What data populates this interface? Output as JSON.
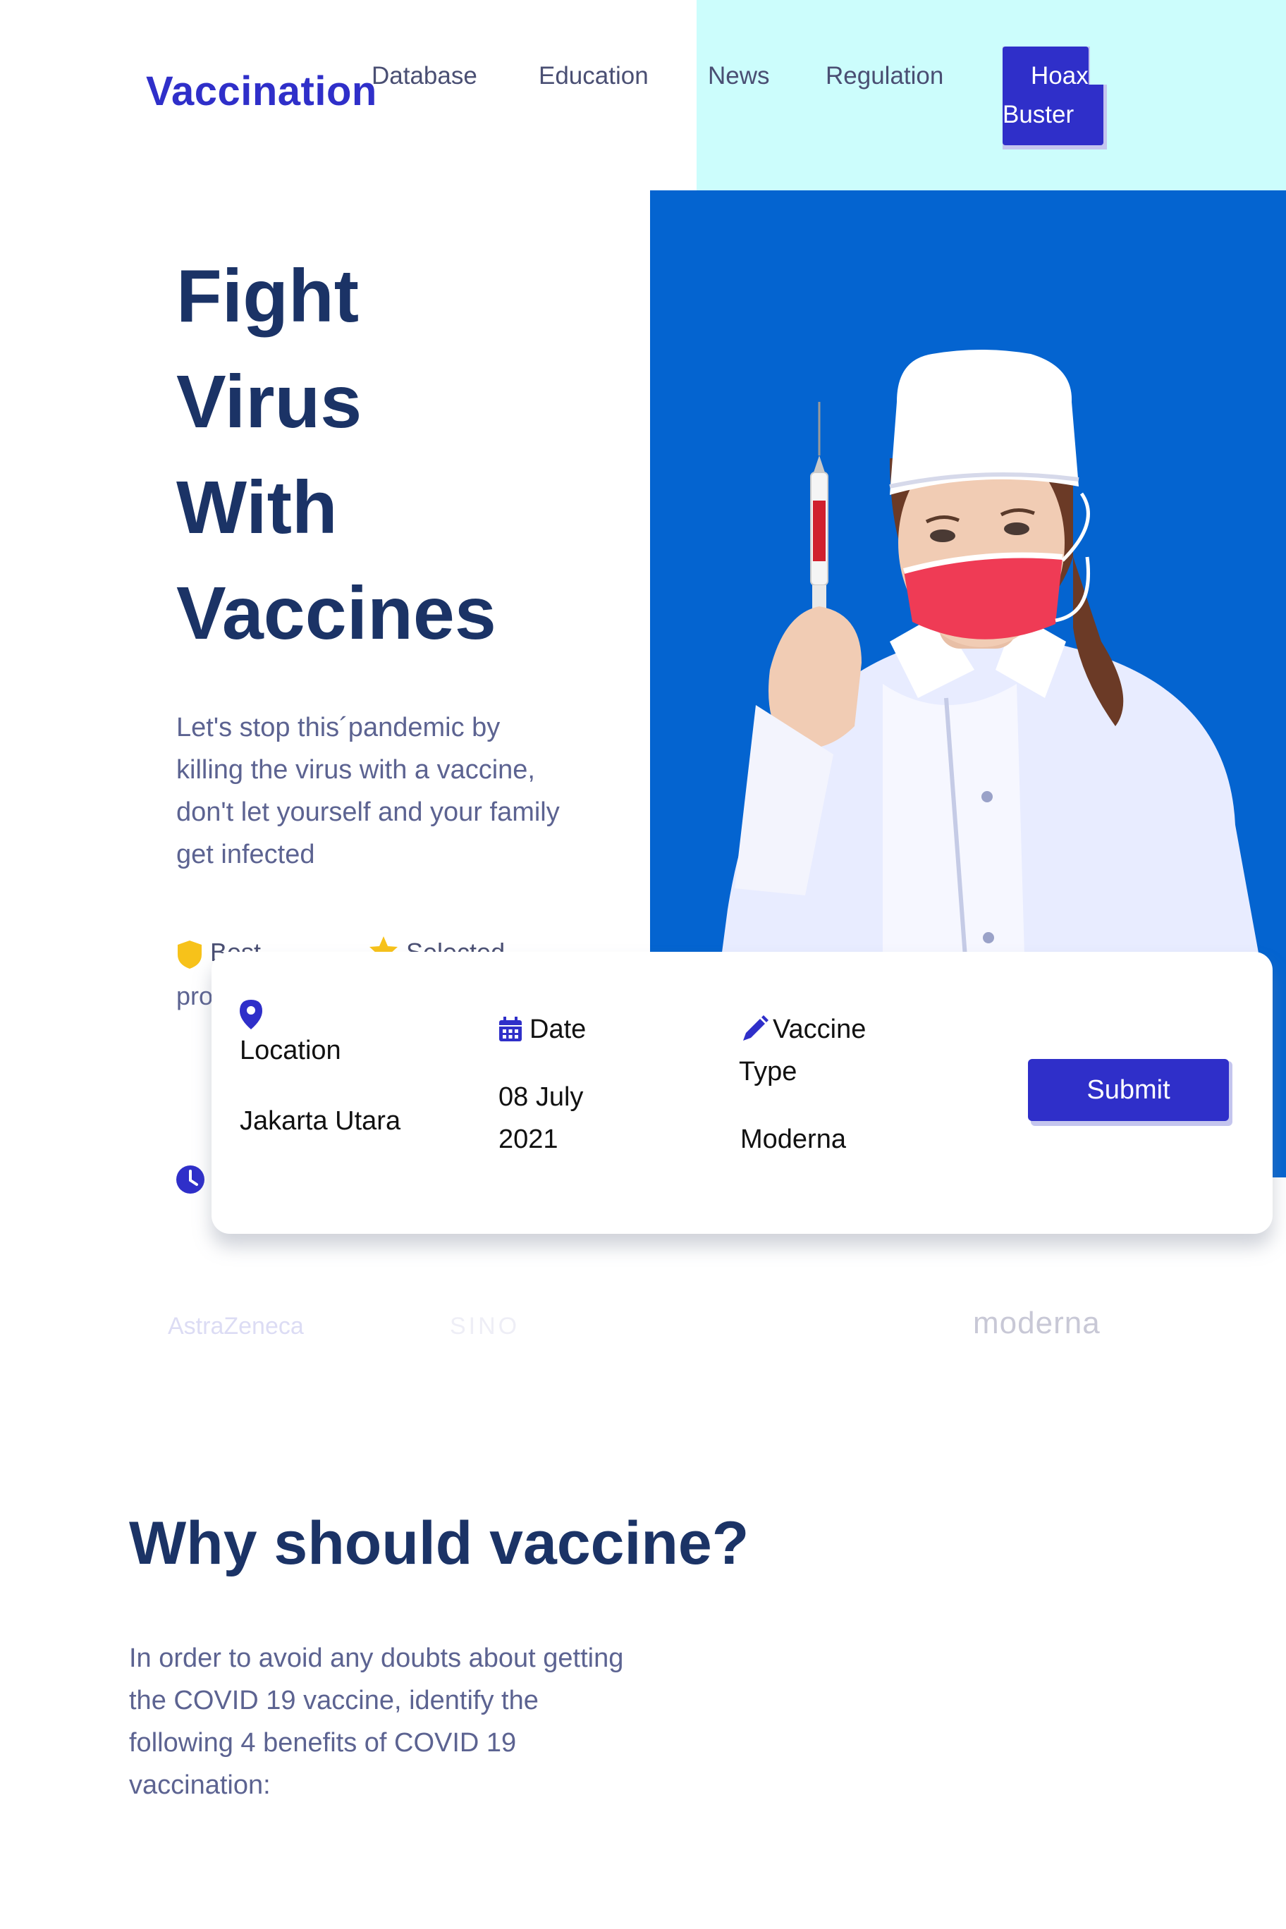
{
  "brand": {
    "logo_text": "Vaccination"
  },
  "nav": {
    "items": [
      {
        "label": "Database"
      },
      {
        "label": "Education"
      },
      {
        "label": "News"
      },
      {
        "label": "Regulation"
      }
    ],
    "cta_line1": "Hoax",
    "cta_line2": "Buster"
  },
  "hero": {
    "title_lines": [
      "Fight",
      "Virus",
      "With",
      "Vaccines"
    ],
    "description": "Let's stop this´pandemic by killing the virus with a vaccine, don't let yourself and your family get infected",
    "features": {
      "first_label": "Best",
      "second_label": "Selected",
      "first_continuation": "pro"
    }
  },
  "booking": {
    "location_label": "Location",
    "location_value": "Jakarta Utara",
    "date_label": "Date",
    "date_value": "08 July 2021",
    "vaccine_label": "Vaccine Type",
    "vaccine_value": "Moderna",
    "submit_label": "Submit"
  },
  "brands": [
    "AstraZeneca",
    "SINO",
    "moderna"
  ],
  "why": {
    "title": "Why should vaccine?",
    "description": "In order to avoid any doubts about getting the COVID 19 vaccine, identify the following 4 benefits of COVID 19 vaccination:"
  },
  "colors": {
    "primary": "#2f2fc9",
    "heading": "#1b3366",
    "body_text": "#5c6391",
    "hero_blue": "#0464d0",
    "header_teal": "#ccfdfc",
    "shield_yellow": "#f7c21a"
  },
  "icons": [
    "map-pin-icon",
    "calendar-icon",
    "pencil-icon",
    "shield-icon",
    "star-icon",
    "clock-icon"
  ]
}
